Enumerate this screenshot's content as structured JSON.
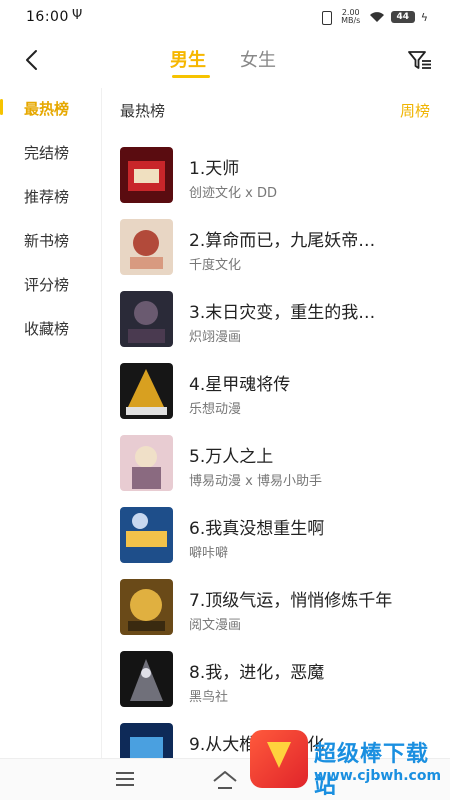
{
  "status_bar": {
    "time": "16:00",
    "usb": "Ψ",
    "speed_value": "2.00",
    "speed_unit": "MB/s",
    "battery": "44",
    "charging": "ϟ"
  },
  "header": {
    "back_icon": "chevron-left-icon",
    "tabs": [
      {
        "label": "男生",
        "active": true
      },
      {
        "label": "女生",
        "active": false
      }
    ],
    "filter_icon": "filter-icon",
    "accent_color": "#f6b700"
  },
  "sidebar": {
    "items": [
      {
        "label": "最热榜",
        "active": true
      },
      {
        "label": "完结榜",
        "active": false
      },
      {
        "label": "推荐榜",
        "active": false
      },
      {
        "label": "新书榜",
        "active": false
      },
      {
        "label": "评分榜",
        "active": false
      },
      {
        "label": "收藏榜",
        "active": false
      }
    ]
  },
  "content": {
    "title": "最热榜",
    "period": "周榜",
    "items": [
      {
        "title": "1.天师",
        "author": "创迹文化 x DD",
        "cover_colors": [
          "#5a0c10",
          "#c8262a"
        ]
      },
      {
        "title": "2.算命而已，九尾妖帝…",
        "author": "千度文化",
        "cover_colors": [
          "#e8d6c4",
          "#b24a3a"
        ]
      },
      {
        "title": "3.末日灾变，重生的我…",
        "author": "炽翊漫画",
        "cover_colors": [
          "#2a2a38",
          "#6a5a70"
        ]
      },
      {
        "title": "4.星甲魂将传",
        "author": "乐想动漫",
        "cover_colors": [
          "#161616",
          "#d8a020"
        ]
      },
      {
        "title": "5.万人之上",
        "author": "博易动漫 x 博易小助手",
        "cover_colors": [
          "#e8ccd2",
          "#8a6a80"
        ]
      },
      {
        "title": "6.我真没想重生啊",
        "author": "噼咔噼",
        "cover_colors": [
          "#1e4e8a",
          "#f2c24a"
        ]
      },
      {
        "title": "7.顶级气运，悄悄修炼千年",
        "author": "阅文漫画",
        "cover_colors": [
          "#6a4a18",
          "#e0b040"
        ]
      },
      {
        "title": "8.我，进化，恶魔",
        "author": "黑鸟社",
        "cover_colors": [
          "#141414",
          "#70707a"
        ]
      },
      {
        "title": "9.从大椎…的进化",
        "author": "",
        "cover_colors": [
          "#0e2a58",
          "#4aa0e0"
        ]
      }
    ]
  },
  "nav_bar": {
    "menu_icon": "menu-icon",
    "home_icon": "home-icon"
  },
  "watermark": {
    "text": "超级棒下载站",
    "url": "www.cjbwh.com"
  }
}
